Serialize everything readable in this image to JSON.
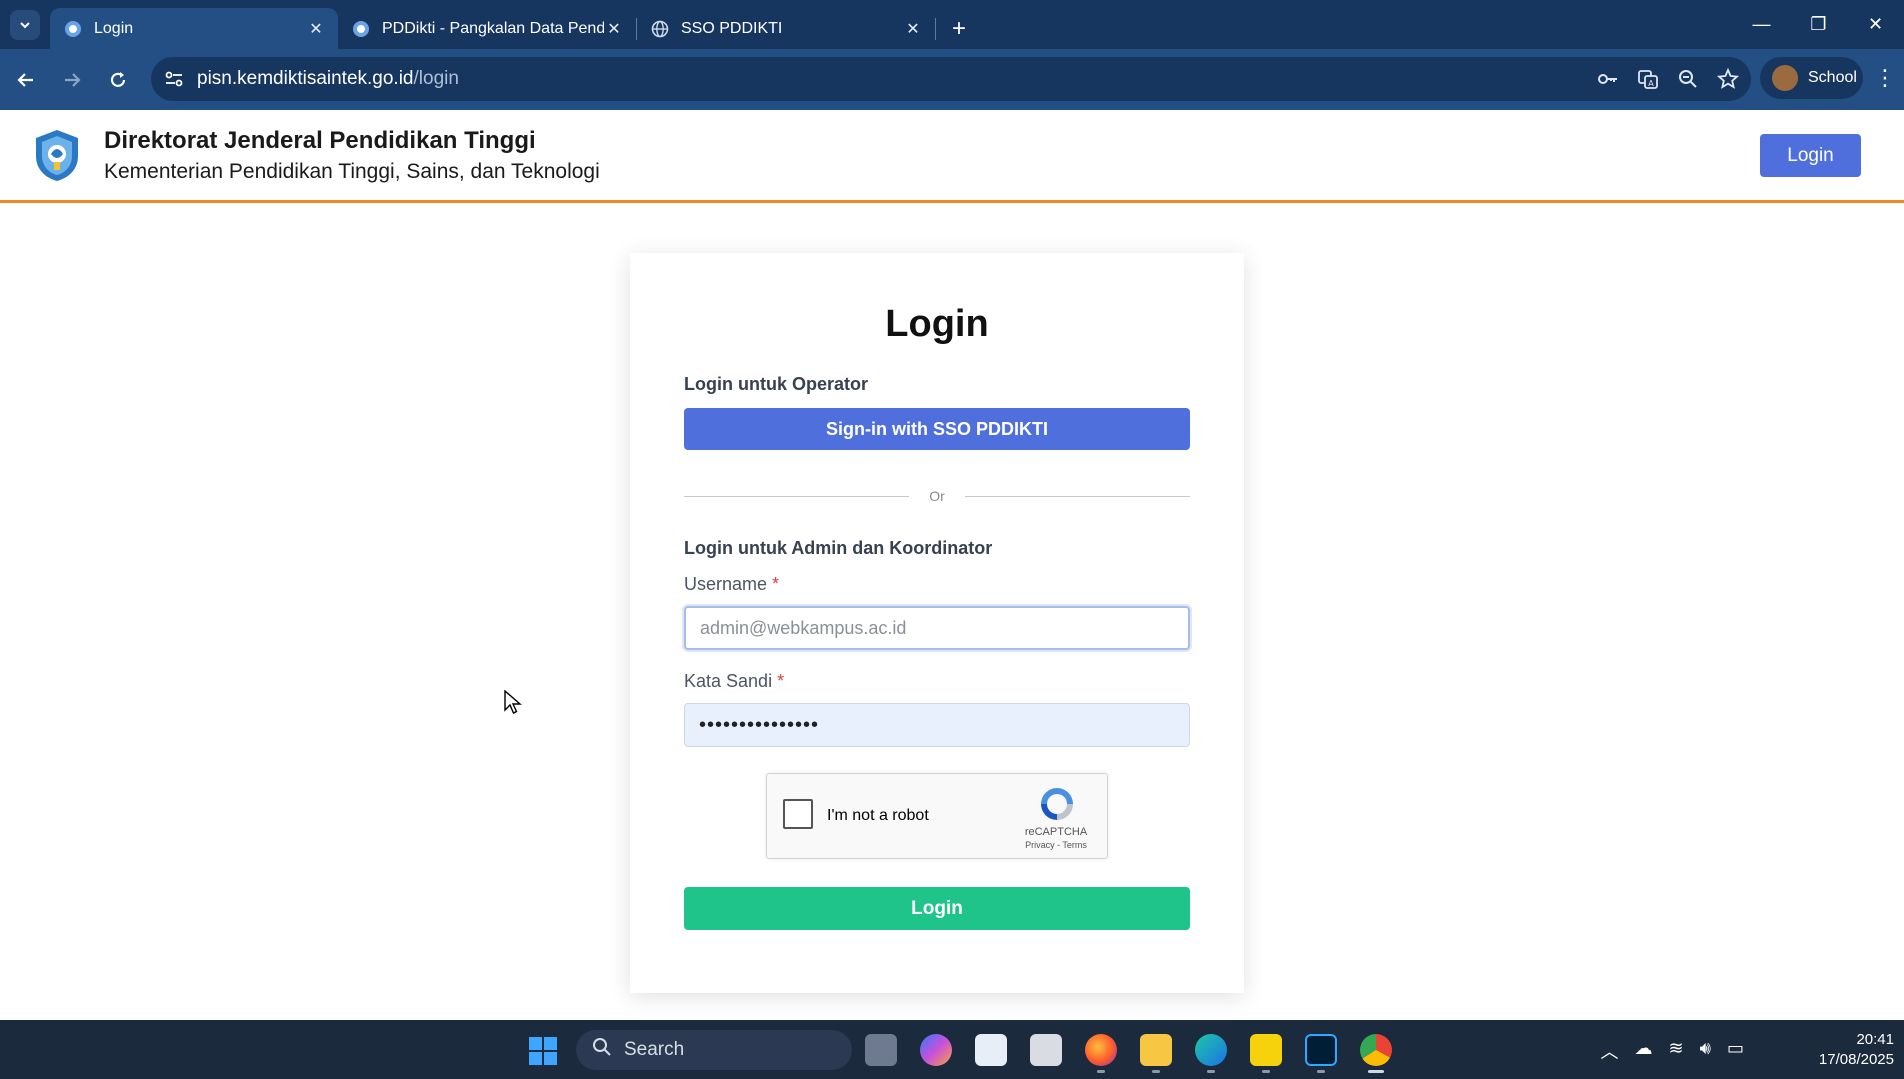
{
  "browser": {
    "tabs": [
      {
        "title": "Login",
        "active": true
      },
      {
        "title": "PDDikti - Pangkalan Data Pendi",
        "active": false
      },
      {
        "title": "SSO PDDIKTI",
        "active": false
      }
    ],
    "url_host": "pisn.kemdiktisaintek.go.id",
    "url_path": "/login",
    "profile_label": "School"
  },
  "header": {
    "title": "Direktorat Jenderal Pendidikan Tinggi",
    "subtitle": "Kementerian Pendidikan Tinggi, Sains, dan Teknologi",
    "login_button": "Login"
  },
  "card": {
    "title": "Login",
    "operator_label": "Login untuk Operator",
    "sso_button": "Sign-in with SSO PDDIKTI",
    "divider_text": "Or",
    "admin_label": "Login untuk Admin dan Koordinator",
    "username_label": "Username",
    "username_placeholder": "admin@webkampus.ac.id",
    "password_label": "Kata Sandi",
    "password_value": "•••••••••••••••",
    "required_mark": "*",
    "captcha_text": "I'm not a robot",
    "captcha_brand": "reCAPTCHA",
    "captcha_terms": "Privacy - Terms",
    "login_button": "Login"
  },
  "taskbar": {
    "search_label": "Search",
    "time": "20:41",
    "date": "17/08/2025"
  },
  "colors": {
    "chrome_dark": "#163660",
    "chrome_toolbar": "#234f85",
    "primary_button": "#4f6fdc",
    "login_green": "#1fc48b",
    "header_accent": "#f08a24"
  }
}
